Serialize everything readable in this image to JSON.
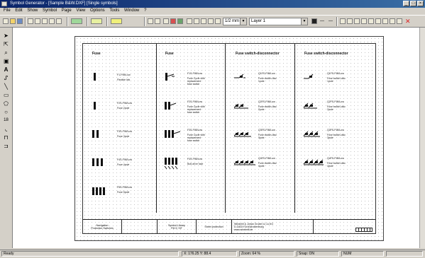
{
  "window": {
    "title": "Symbol Generator - [Sample B&W.DXF] [Single symbols]",
    "controls": [
      "minimize",
      "maximize",
      "close"
    ]
  },
  "menu": [
    "File",
    "Edit",
    "Show",
    "Symbol",
    "Page",
    "View",
    "Options",
    "Tools",
    "Window",
    "?"
  ],
  "toolbar": {
    "size_combo": "1/2 mm",
    "layer_combo": "Layer 1"
  },
  "drawing": {
    "columns": [
      {
        "header": "Fuse"
      },
      {
        "header": "Fuse"
      },
      {
        "header": "Fuse switch-disconnector"
      },
      {
        "header": "Fuse switch-disconnector"
      }
    ],
    "rows": [
      [
        {
          "line1": "F1-F98/Low",
          "line2": "Flexible link"
        },
        {
          "line1": "F1S-F98/Low",
          "line2": "Fuse Cycle with\nreplacement\nfuse switch"
        },
        {
          "line1": "Q1FS-F98/Low",
          "line2": "Fuse switch-disc\n1pole"
        },
        {
          "line1": "Q1FS-F98/Low",
          "line2": "Fuse switch-disc\n1pole"
        }
      ],
      [
        {
          "line1": "F2S-F98/Low",
          "line2": "Fuse 2pole"
        },
        {
          "line1": "F2S-F98/Low",
          "line2": "Fuse Cycle with\nreplacement\nfuse switch"
        },
        {
          "line1": "Q2FS-F98/Low",
          "line2": "Fuse switch-disc\n2pole"
        },
        {
          "line1": "Q2FS-F98/Low",
          "line2": "Fuse switch-disc\n2pole"
        }
      ],
      [
        {
          "line1": "F3S-F98/Low",
          "line2": "Fuse 3pole"
        },
        {
          "line1": "F3S-F98/Low",
          "line2": "Fuse Cycle with\nreplacement\nfuse switch"
        },
        {
          "line1": "Q3FS-F98/Low",
          "line2": "Fuse switch-disc\n3pole"
        },
        {
          "line1": "Q3FS-F98/Low",
          "line2": "Fuse switch-disc\n3pole"
        }
      ],
      [
        {
          "line1": "F4S-F98/Low",
          "line2": "Fuse 4pole"
        },
        {
          "line1": "F4S-F98/Low",
          "line2": "Bolt-drive fuse"
        },
        {
          "line1": "Q4FS-F98/Low",
          "line2": "Fuse switch-disc\n4pole"
        },
        {
          "line1": "Q4FS-F98/Low",
          "line2": "Fuse switch-disc\n4pole"
        }
      ],
      [
        {
          "line1": "F5S-F98/Low",
          "line2": "Fuse 5pole"
        },
        null,
        null,
        null
      ]
    ],
    "title_block": {
      "cell1": "Navigation\nProtection Switches",
      "cell2": "",
      "cell3": "Symbol Library\nF5CC SIT",
      "cell4": "Sheet protection",
      "cell5": "Windmill & Johan Gruber & Co.KG\nD-18119 Großkrotzenburg\nwww.windmill.de",
      "cell6": ""
    }
  },
  "status": {
    "panel1": "Ready",
    "panel2": "X: 176.25  Y: 88.4",
    "panel3": "Zoom: 64 %",
    "panel4": "Snap: ON",
    "panel5": "NUM"
  }
}
